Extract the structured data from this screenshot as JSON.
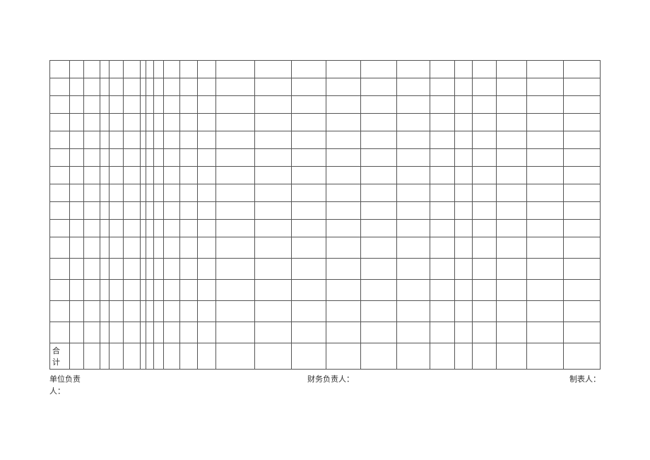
{
  "table": {
    "total_label": "合计",
    "data_rows": 15,
    "taller_rows_after_index": 10
  },
  "footer": {
    "left": "单位负责人：",
    "center": "财务负责人：",
    "right": "制表人："
  }
}
